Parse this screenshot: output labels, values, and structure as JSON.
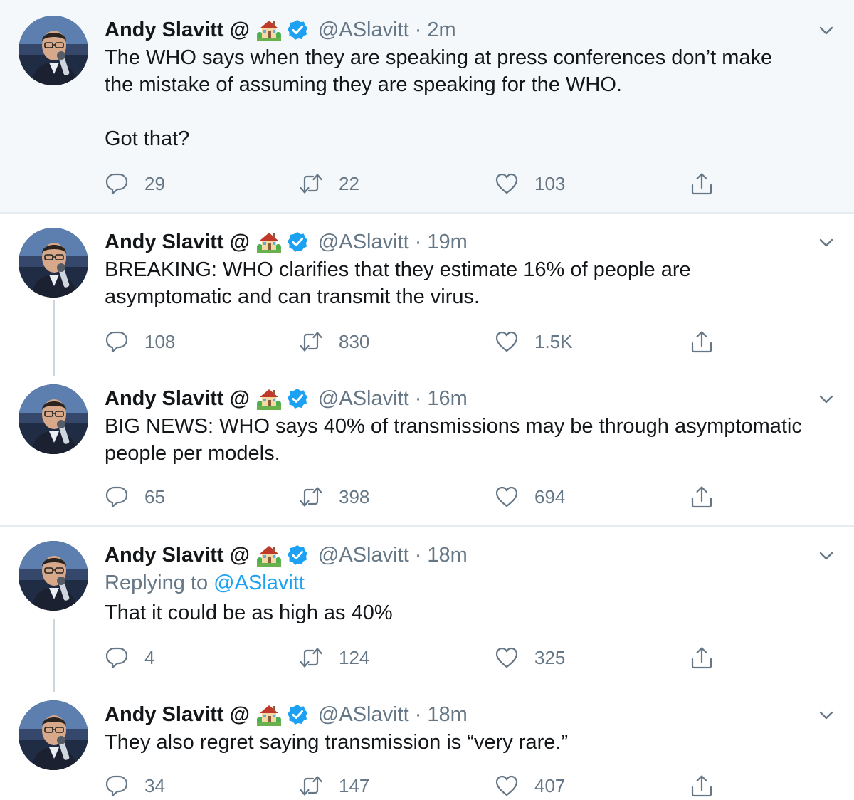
{
  "colors": {
    "accent": "#1da1f2",
    "muted": "#657786",
    "text": "#14171a",
    "highlight_bg": "#f5f8fa",
    "divider": "#e6ecf0"
  },
  "icons": {
    "reply": "speech-bubble-icon",
    "retweet": "retweet-icon",
    "like": "heart-icon",
    "share": "share-icon",
    "more": "chevron-down-icon",
    "verified": "verified-badge-icon",
    "emoji": "house-with-garden-emoji"
  },
  "tweets": [
    {
      "name": "Andy Slavitt @",
      "handle": "@ASlavitt",
      "separator": "·",
      "time": "2m",
      "lines": [
        "The WHO says when they are speaking at press conferences don’t make",
        "the mistake of assuming they are speaking for the WHO."
      ],
      "extra_line": "Got that?",
      "replies": "29",
      "retweets": "22",
      "likes": "103"
    },
    {
      "name": "Andy Slavitt @",
      "handle": "@ASlavitt",
      "separator": "·",
      "time": "19m",
      "lines": [
        "BREAKING: WHO clarifies that they estimate 16% of people are",
        "asymptomatic and can transmit the virus."
      ],
      "replies": "108",
      "retweets": "830",
      "likes": "1.5K"
    },
    {
      "name": "Andy Slavitt @",
      "handle": "@ASlavitt",
      "separator": "·",
      "time": "16m",
      "lines": [
        "BIG NEWS: WHO says 40% of transmissions may be through asymptomatic",
        "people per models."
      ],
      "replies": "65",
      "retweets": "398",
      "likes": "694"
    },
    {
      "name": "Andy Slavitt @",
      "handle": "@ASlavitt",
      "separator": "·",
      "time": "18m",
      "replying_prefix": "Replying to",
      "replying_handle": "@ASlavitt",
      "lines": [
        "That it could be as high as 40%"
      ],
      "replies": "4",
      "retweets": "124",
      "likes": "325"
    },
    {
      "name": "Andy Slavitt @",
      "handle": "@ASlavitt",
      "separator": "·",
      "time": "18m",
      "lines": [
        "They also regret saying transmission is “very rare.”"
      ],
      "replies": "34",
      "retweets": "147",
      "likes": "407"
    }
  ]
}
